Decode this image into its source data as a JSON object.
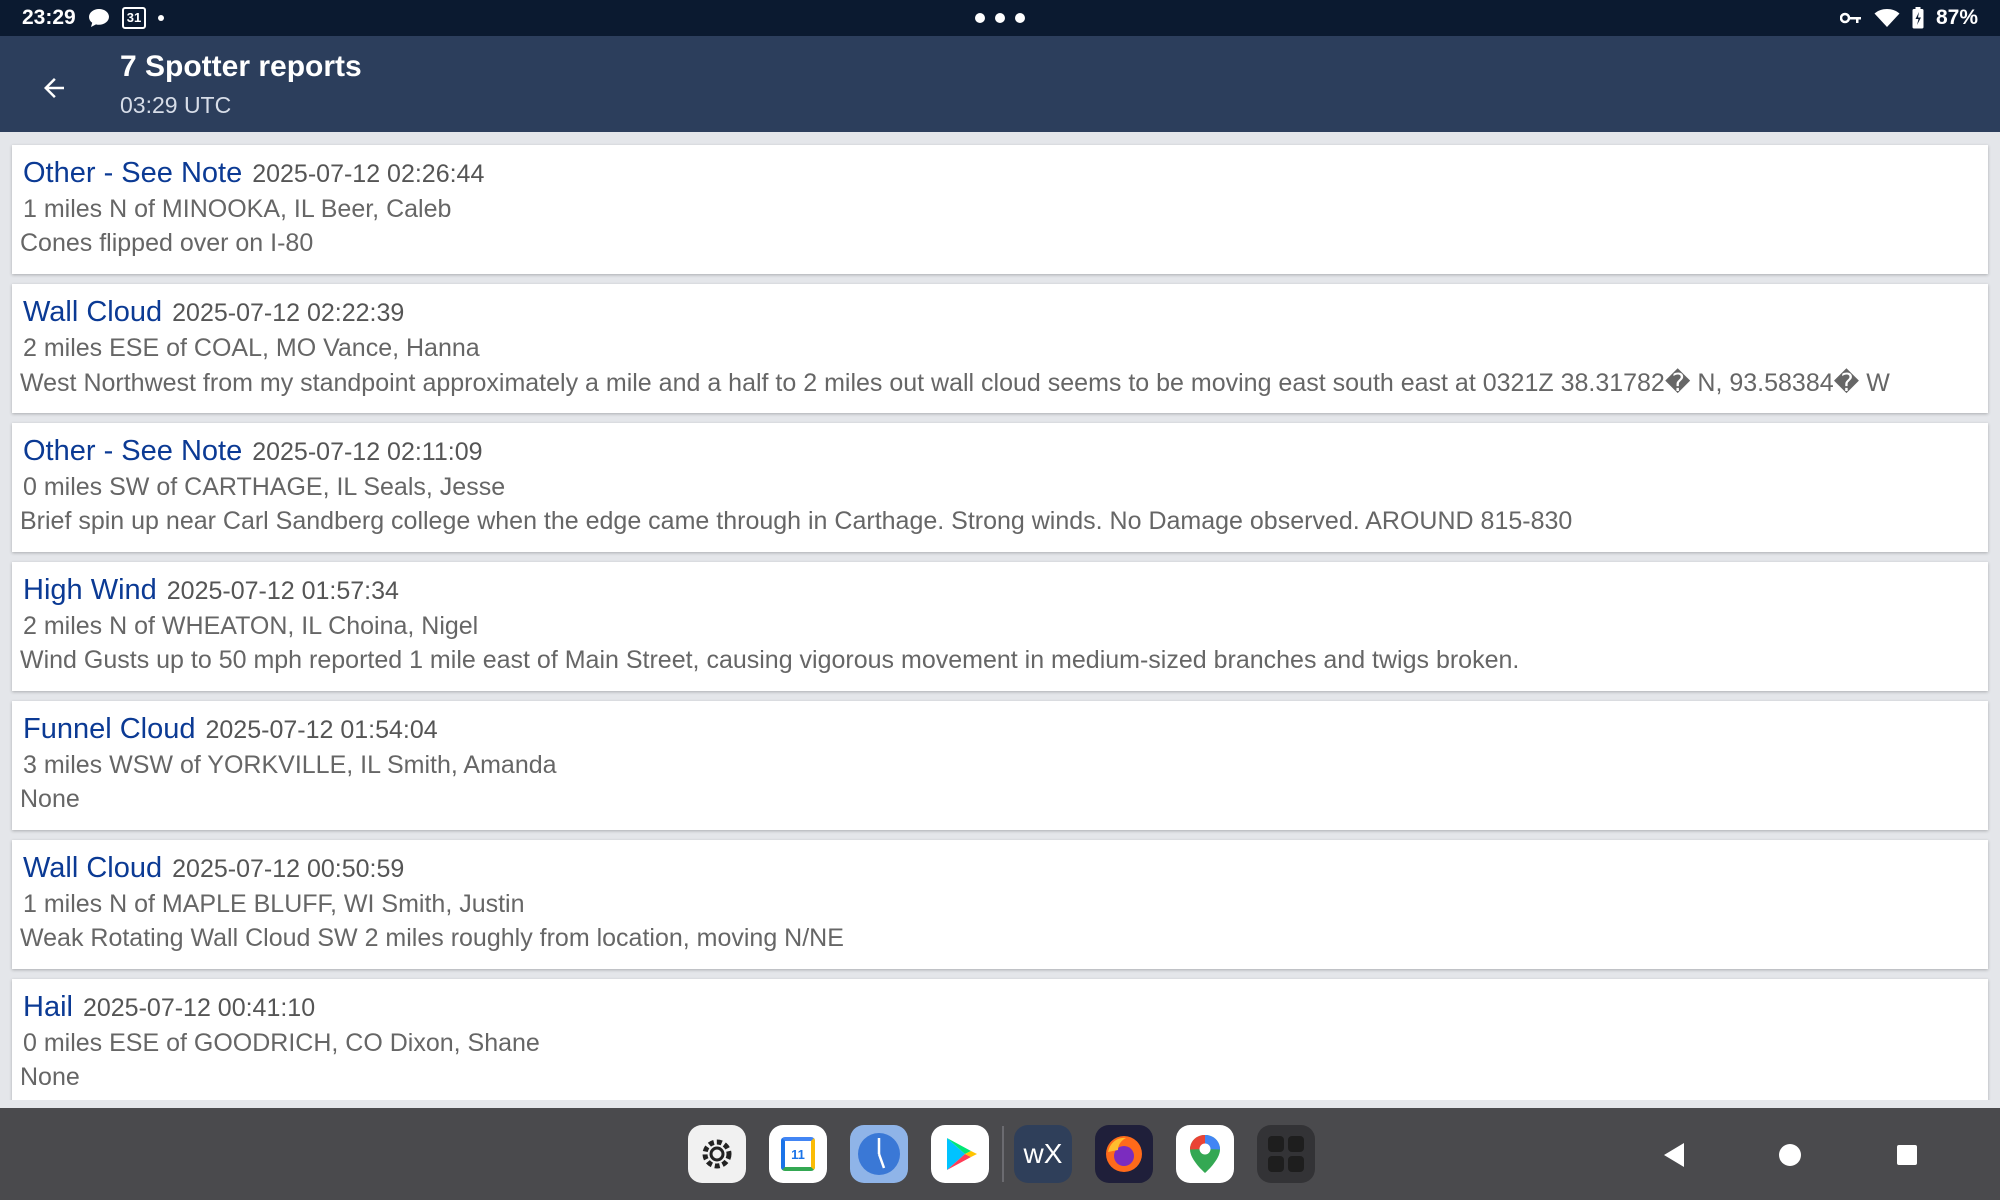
{
  "status_bar": {
    "time": "23:29",
    "calendar_day": "31",
    "battery": "87%",
    "icons": [
      "chat-icon",
      "calendar-icon",
      "key-icon",
      "wifi-icon",
      "battery-icon"
    ]
  },
  "toolbar": {
    "title": "7 Spotter reports",
    "subtitle": "03:29 UTC"
  },
  "reports": [
    {
      "type": "Other - See Note",
      "time": "2025-07-12 02:26:44",
      "location": "1 miles N of MINOOKA, IL  Beer, Caleb",
      "note": "Cones flipped over on I-80"
    },
    {
      "type": "Wall Cloud",
      "time": "2025-07-12 02:22:39",
      "location": "2 miles ESE of COAL, MO  Vance, Hanna",
      "note": "West Northwest from my standpoint approximately a mile and a half to 2 miles out wall cloud seems to be moving east south east at 0321Z 38.31782� N, 93.58384� W"
    },
    {
      "type": "Other - See Note",
      "time": "2025-07-12 02:11:09",
      "location": "0 miles SW of CARTHAGE, IL  Seals, Jesse",
      "note": "Brief spin up near Carl Sandberg college when the edge came through in Carthage. Strong winds. No Damage observed. AROUND 815-830"
    },
    {
      "type": "High Wind",
      "time": "2025-07-12 01:57:34",
      "location": "2 miles N of WHEATON, IL  Choina, Nigel",
      "note": "Wind Gusts up to 50 mph reported 1 mile east of Main Street, causing vigorous movement in medium-sized branches and twigs broken."
    },
    {
      "type": "Funnel Cloud",
      "time": "2025-07-12 01:54:04",
      "location": "3 miles WSW of YORKVILLE, IL  Smith, Amanda",
      "note": "None"
    },
    {
      "type": "Wall Cloud",
      "time": "2025-07-12 00:50:59",
      "location": "1 miles N of MAPLE BLUFF, WI  Smith, Justin",
      "note": "Weak Rotating Wall Cloud SW 2 miles roughly from location, moving N/NE"
    },
    {
      "type": "Hail",
      "time": "2025-07-12 00:41:10",
      "location": "0 miles ESE of GOODRICH, CO  Dixon, Shane",
      "note": "None"
    }
  ],
  "dock": {
    "apps": [
      "settings-icon",
      "google-calendar-icon",
      "clock-icon",
      "play-store-icon",
      "wx-app-icon",
      "firefox-icon",
      "maps-icon",
      "app-drawer-icon"
    ],
    "wx_label": "wX",
    "calendar_label": "11"
  },
  "colors": {
    "toolbar": "#2c3e5c",
    "status_bar": "#0b1a30",
    "report_type": "#0b3a94",
    "background": "#e4e6ea"
  }
}
